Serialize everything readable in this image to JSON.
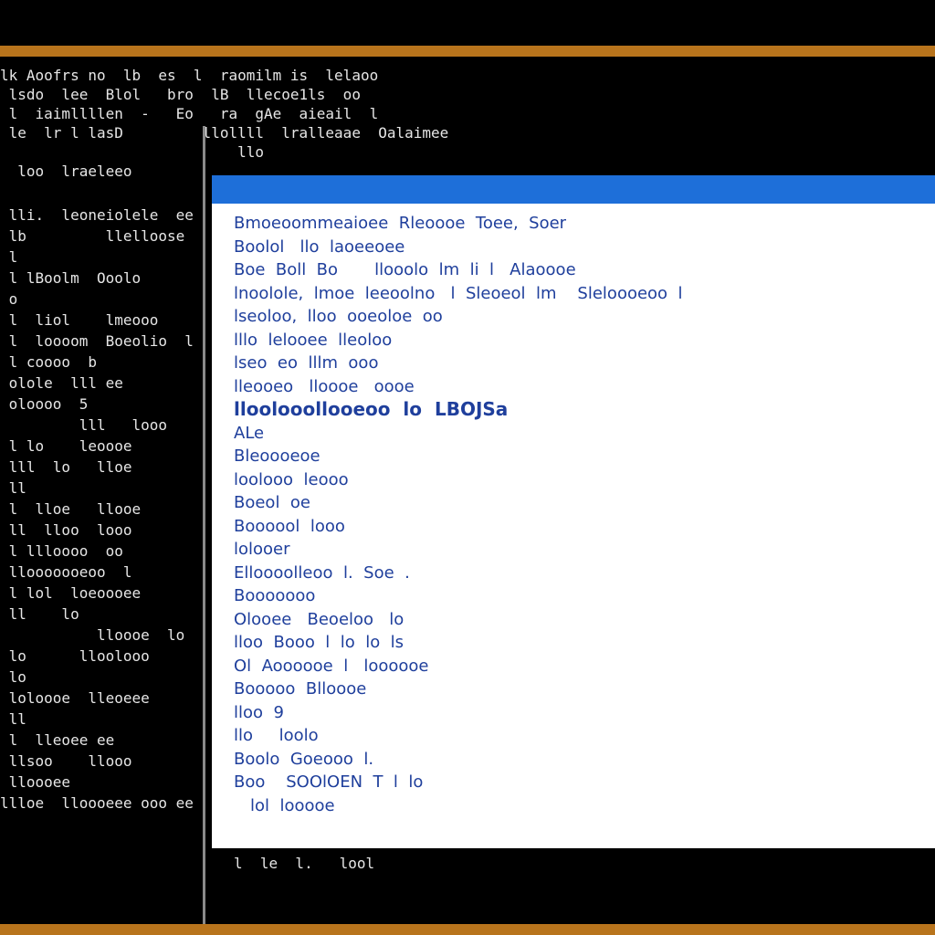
{
  "terminal": {
    "top_lines": [
      "lk Aoofrs no  lb  es  l  raomilm is  lelaoo",
      " lsdo  lee  Blol   bro  lB  llecoe1ls  oo",
      " l  iaimllllen  -   Eo   ra  gAe  aieail  l",
      " le  lr l lasD         llollll  lralleaae  Oalaimee",
      "                           llo",
      "  loo  lraeleeo"
    ],
    "left_lines": [
      " lli.  leoneiolele  ee",
      " lb         llelloose",
      " l",
      " l lBoolm  Ooolo",
      " o",
      " l  liol    lmeooo",
      " l  loooom  Boeolio  l",
      " l coooo  b",
      " olole  lll ee",
      " oloooo  5",
      "         lll   looo",
      " l lo    leoooe",
      " lll  lo   lloe",
      " ll",
      " l  lloe   llooe",
      " ll  lloo  looo",
      " l llloooo  oo",
      " llooooooeoo  l",
      " l lol  loeoooee",
      " ll    lo",
      "           lloooe  lo",
      " lo      lloolooo",
      " lo",
      " loloooe  lleoeee",
      " ll",
      " l  lleoee ee",
      " llsoo    llooo",
      " lloooee",
      "llloe  lloooeee ooo ee"
    ],
    "footer_line": "l  le  l.   lool"
  },
  "dialog": {
    "lines": [
      "Bmoeoommeaioee  Rleoooe  Toee,  Soer",
      "Boolol   llo  laoeeoee",
      "Boe  Boll  Bo       llooolo  lm  li  l   Alaoooe",
      "lnoolole,  lmoe  leeoolno   l  Sleoeol  lm    Sleloooeoo  l",
      "lseoloo,  lloo  ooeoloe  oo",
      "lllo  lelooee  lleoloo",
      "lseo  eo  lllm  ooo",
      "lleooeo   lloooe   oooe",
      "lloolooollooeoo  lo  LBOJSa",
      "ALe",
      "Bleoooeoe",
      "loolooo  leooo",
      "Boeol  oe",
      "Boooool  looo",
      "lolooer",
      "Elloooolleoo  l.  Soe  .",
      "Booooooo",
      "Olooee   Beoeloo   lo",
      "lloo  Booo  l  lo  lo  ls",
      "Ol  Aoooooe  l   loooooe",
      "Booooo  Blloooe",
      "lloo  9",
      "llo     loolo",
      "Boolo  Goeooo  l.",
      "Boo    SOOlOEN  T  l  lo",
      "lol  looooe"
    ]
  },
  "colors": {
    "frame_orange": "#b8741c",
    "dialog_title_blue": "#1e6fd9",
    "dialog_text_blue": "#1f3f9c",
    "accent_teal": "#14867a"
  }
}
